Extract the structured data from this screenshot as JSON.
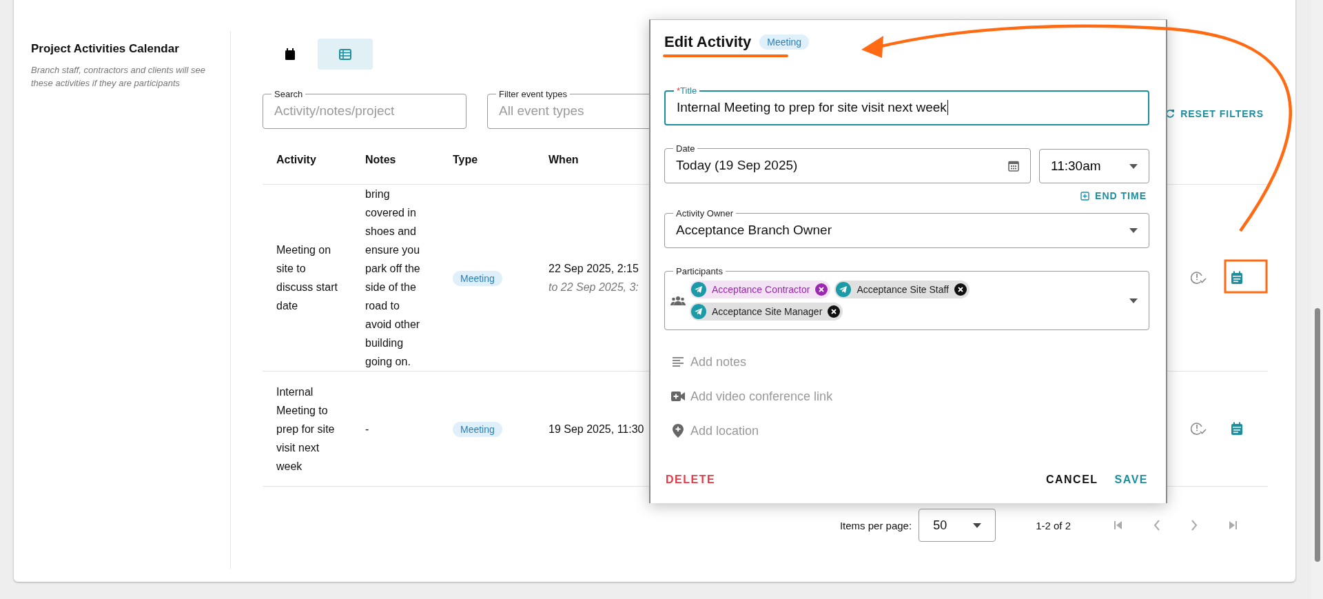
{
  "section": {
    "title": "Project Activities Calendar",
    "description": "Branch staff, contractors and clients will see these activities if they are participants"
  },
  "view_toggle": [
    {
      "kind": "calendar",
      "selected": false
    },
    {
      "kind": "list",
      "selected": true
    }
  ],
  "filters": {
    "search": {
      "label": "Search",
      "placeholder": "Activity/notes/project"
    },
    "event_types": {
      "label": "Filter event types",
      "placeholder": "All event types"
    },
    "reset": "RESET FILTERS"
  },
  "table": {
    "columns": [
      "Activity",
      "Notes",
      "Type",
      "When"
    ],
    "rows": [
      {
        "activity": "Meeting on site to discuss start date",
        "notes": "bring covered in shoes and ensure you park off the side of the road to avoid other building going on.",
        "type": "Meeting",
        "when": "22 Sep 2025, 2:15",
        "when_end": "to 22 Sep 2025, 3:"
      },
      {
        "activity": "Internal Meeting to prep for site visit next week",
        "notes": "-",
        "type": "Meeting",
        "when": "19 Sep 2025, 11:30"
      }
    ]
  },
  "pagination": {
    "label": "Items per page:",
    "per_page": "50",
    "range": "1-2 of 2"
  },
  "dialog": {
    "title": "Edit Activity",
    "badge": "Meeting",
    "title_field": {
      "label": "Title",
      "required_mark": "*",
      "value": "Internal Meeting to prep for site visit next week"
    },
    "date": {
      "label": "Date",
      "value": "Today (19 Sep 2025)"
    },
    "time": {
      "value": "11:30am"
    },
    "end_time": "END TIME",
    "owner": {
      "label": "Activity Owner",
      "value": "Acceptance Branch Owner"
    },
    "participants": {
      "label": "Participants",
      "chips": [
        {
          "name": "Acceptance Contractor",
          "color": "#9c27b0"
        },
        {
          "name": "Acceptance Site Staff",
          "color": "#111111"
        },
        {
          "name": "Acceptance Site Manager",
          "color": "#111111"
        }
      ]
    },
    "extras": [
      {
        "kind": "notes",
        "placeholder": "Add notes"
      },
      {
        "kind": "video",
        "placeholder": "Add video conference link"
      },
      {
        "kind": "location",
        "placeholder": "Add location"
      }
    ],
    "actions": {
      "delete": "DELETE",
      "cancel": "CANCEL",
      "save": "SAVE"
    }
  }
}
